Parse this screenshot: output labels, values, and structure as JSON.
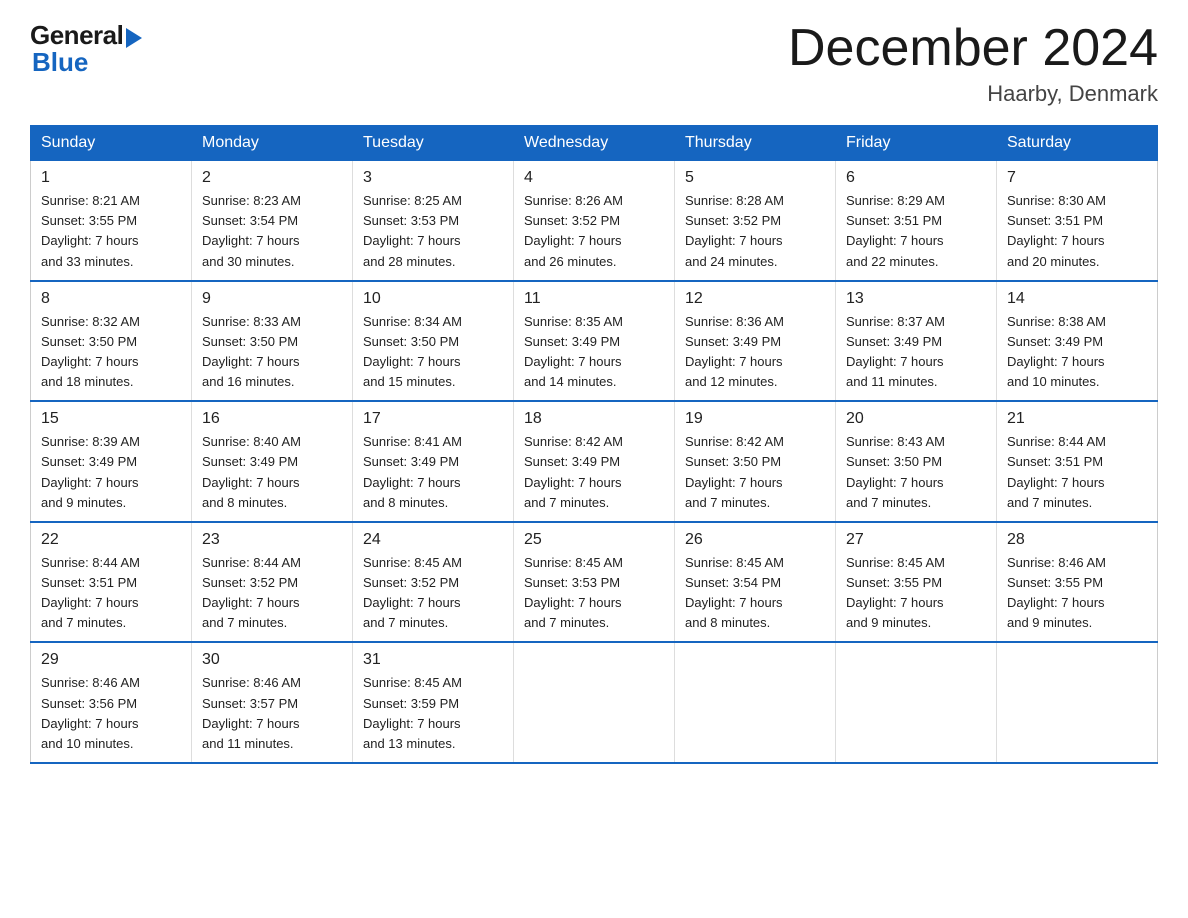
{
  "logo": {
    "general": "General",
    "blue": "Blue"
  },
  "header": {
    "title": "December 2024",
    "location": "Haarby, Denmark"
  },
  "days_of_week": [
    "Sunday",
    "Monday",
    "Tuesday",
    "Wednesday",
    "Thursday",
    "Friday",
    "Saturday"
  ],
  "weeks": [
    [
      {
        "day": "1",
        "sunrise": "8:21 AM",
        "sunset": "3:55 PM",
        "daylight": "7 hours and 33 minutes."
      },
      {
        "day": "2",
        "sunrise": "8:23 AM",
        "sunset": "3:54 PM",
        "daylight": "7 hours and 30 minutes."
      },
      {
        "day": "3",
        "sunrise": "8:25 AM",
        "sunset": "3:53 PM",
        "daylight": "7 hours and 28 minutes."
      },
      {
        "day": "4",
        "sunrise": "8:26 AM",
        "sunset": "3:52 PM",
        "daylight": "7 hours and 26 minutes."
      },
      {
        "day": "5",
        "sunrise": "8:28 AM",
        "sunset": "3:52 PM",
        "daylight": "7 hours and 24 minutes."
      },
      {
        "day": "6",
        "sunrise": "8:29 AM",
        "sunset": "3:51 PM",
        "daylight": "7 hours and 22 minutes."
      },
      {
        "day": "7",
        "sunrise": "8:30 AM",
        "sunset": "3:51 PM",
        "daylight": "7 hours and 20 minutes."
      }
    ],
    [
      {
        "day": "8",
        "sunrise": "8:32 AM",
        "sunset": "3:50 PM",
        "daylight": "7 hours and 18 minutes."
      },
      {
        "day": "9",
        "sunrise": "8:33 AM",
        "sunset": "3:50 PM",
        "daylight": "7 hours and 16 minutes."
      },
      {
        "day": "10",
        "sunrise": "8:34 AM",
        "sunset": "3:50 PM",
        "daylight": "7 hours and 15 minutes."
      },
      {
        "day": "11",
        "sunrise": "8:35 AM",
        "sunset": "3:49 PM",
        "daylight": "7 hours and 14 minutes."
      },
      {
        "day": "12",
        "sunrise": "8:36 AM",
        "sunset": "3:49 PM",
        "daylight": "7 hours and 12 minutes."
      },
      {
        "day": "13",
        "sunrise": "8:37 AM",
        "sunset": "3:49 PM",
        "daylight": "7 hours and 11 minutes."
      },
      {
        "day": "14",
        "sunrise": "8:38 AM",
        "sunset": "3:49 PM",
        "daylight": "7 hours and 10 minutes."
      }
    ],
    [
      {
        "day": "15",
        "sunrise": "8:39 AM",
        "sunset": "3:49 PM",
        "daylight": "7 hours and 9 minutes."
      },
      {
        "day": "16",
        "sunrise": "8:40 AM",
        "sunset": "3:49 PM",
        "daylight": "7 hours and 8 minutes."
      },
      {
        "day": "17",
        "sunrise": "8:41 AM",
        "sunset": "3:49 PM",
        "daylight": "7 hours and 8 minutes."
      },
      {
        "day": "18",
        "sunrise": "8:42 AM",
        "sunset": "3:49 PM",
        "daylight": "7 hours and 7 minutes."
      },
      {
        "day": "19",
        "sunrise": "8:42 AM",
        "sunset": "3:50 PM",
        "daylight": "7 hours and 7 minutes."
      },
      {
        "day": "20",
        "sunrise": "8:43 AM",
        "sunset": "3:50 PM",
        "daylight": "7 hours and 7 minutes."
      },
      {
        "day": "21",
        "sunrise": "8:44 AM",
        "sunset": "3:51 PM",
        "daylight": "7 hours and 7 minutes."
      }
    ],
    [
      {
        "day": "22",
        "sunrise": "8:44 AM",
        "sunset": "3:51 PM",
        "daylight": "7 hours and 7 minutes."
      },
      {
        "day": "23",
        "sunrise": "8:44 AM",
        "sunset": "3:52 PM",
        "daylight": "7 hours and 7 minutes."
      },
      {
        "day": "24",
        "sunrise": "8:45 AM",
        "sunset": "3:52 PM",
        "daylight": "7 hours and 7 minutes."
      },
      {
        "day": "25",
        "sunrise": "8:45 AM",
        "sunset": "3:53 PM",
        "daylight": "7 hours and 7 minutes."
      },
      {
        "day": "26",
        "sunrise": "8:45 AM",
        "sunset": "3:54 PM",
        "daylight": "7 hours and 8 minutes."
      },
      {
        "day": "27",
        "sunrise": "8:45 AM",
        "sunset": "3:55 PM",
        "daylight": "7 hours and 9 minutes."
      },
      {
        "day": "28",
        "sunrise": "8:46 AM",
        "sunset": "3:55 PM",
        "daylight": "7 hours and 9 minutes."
      }
    ],
    [
      {
        "day": "29",
        "sunrise": "8:46 AM",
        "sunset": "3:56 PM",
        "daylight": "7 hours and 10 minutes."
      },
      {
        "day": "30",
        "sunrise": "8:46 AM",
        "sunset": "3:57 PM",
        "daylight": "7 hours and 11 minutes."
      },
      {
        "day": "31",
        "sunrise": "8:45 AM",
        "sunset": "3:59 PM",
        "daylight": "7 hours and 13 minutes."
      },
      null,
      null,
      null,
      null
    ]
  ],
  "labels": {
    "sunrise": "Sunrise:",
    "sunset": "Sunset:",
    "daylight": "Daylight:"
  }
}
